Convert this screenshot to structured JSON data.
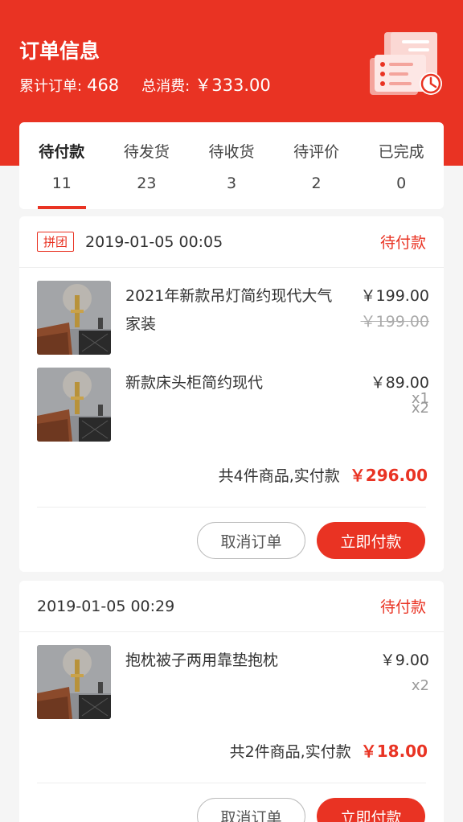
{
  "header": {
    "title": "订单信息",
    "orders_label": "累计订单:",
    "orders_value": "468",
    "spend_label": "总消费:",
    "spend_value": "￥333.00",
    "illustration_icon": "receipt-scroll-clock-icon"
  },
  "tabs": [
    {
      "label": "待付款",
      "count": "11",
      "active": true
    },
    {
      "label": "待发货",
      "count": "23"
    },
    {
      "label": "待收货",
      "count": "3"
    },
    {
      "label": "待评价",
      "count": "2"
    },
    {
      "label": "已完成",
      "count": "0"
    }
  ],
  "orders": [
    {
      "tag": "拼团",
      "date": "2019-01-05 00:05",
      "status": "待付款",
      "items": [
        {
          "title": "2021年新款吊灯简约现代大气家装",
          "price": "￥199.00",
          "original_price": "￥199.00",
          "qty": "x1"
        },
        {
          "title": "新款床头柜简约现代",
          "price": "￥89.00",
          "qty": "x2"
        }
      ],
      "summary": "共4件商品,实付款",
      "total": "￥296.00",
      "cancel_label": "取消订单",
      "pay_label": "立即付款"
    },
    {
      "date": "2019-01-05 00:29",
      "status": "待付款",
      "items": [
        {
          "title": "抱枕被子两用靠垫抱枕",
          "price": "￥9.00",
          "qty": "x2"
        }
      ],
      "summary": "共2件商品,实付款",
      "total": "￥18.00",
      "cancel_label": "取消订单",
      "pay_label": "立即付款"
    }
  ],
  "colors": {
    "accent": "#e93323",
    "background": "#f5f5f5"
  }
}
